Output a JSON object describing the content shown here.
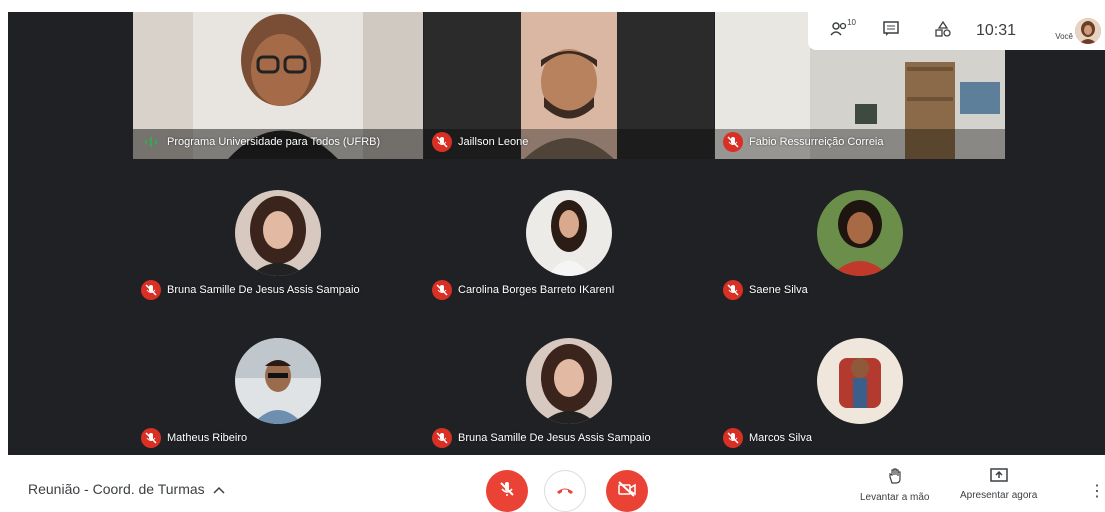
{
  "participants": {
    "row1": [
      {
        "name": "Programa Universidade para Todos (UFRB)",
        "status": "speaking"
      },
      {
        "name": "Jaillson Leone",
        "status": "muted"
      },
      {
        "name": "Fabio Ressurreição Correia",
        "status": "muted"
      }
    ],
    "row2": [
      {
        "name": "Bruna Samille De Jesus Assis Sampaio",
        "status": "muted"
      },
      {
        "name": "Carolina Borges Barreto IKarenI",
        "status": "muted"
      },
      {
        "name": "Saene Silva",
        "status": "muted"
      }
    ],
    "row3": [
      {
        "name": "Matheus Ribeiro",
        "status": "muted"
      },
      {
        "name": "Bruna Samille De Jesus Assis Sampaio",
        "status": "muted"
      },
      {
        "name": "Marcos Silva",
        "status": "muted"
      }
    ]
  },
  "topbar": {
    "people_count": "10",
    "time": "10:31",
    "you_label": "Você",
    "icons": [
      "people-icon",
      "chat-icon",
      "activities-icon"
    ]
  },
  "bottombar": {
    "meeting_title": "Reunião - Coord. de Turmas",
    "raise_hand": "Levantar a mão",
    "present_now": "Apresentar agora",
    "more": "⋮"
  },
  "colors": {
    "grid_bg": "#202124",
    "muted": "#d93025",
    "control_red": "#ea4335",
    "speaking": "#34a853"
  }
}
